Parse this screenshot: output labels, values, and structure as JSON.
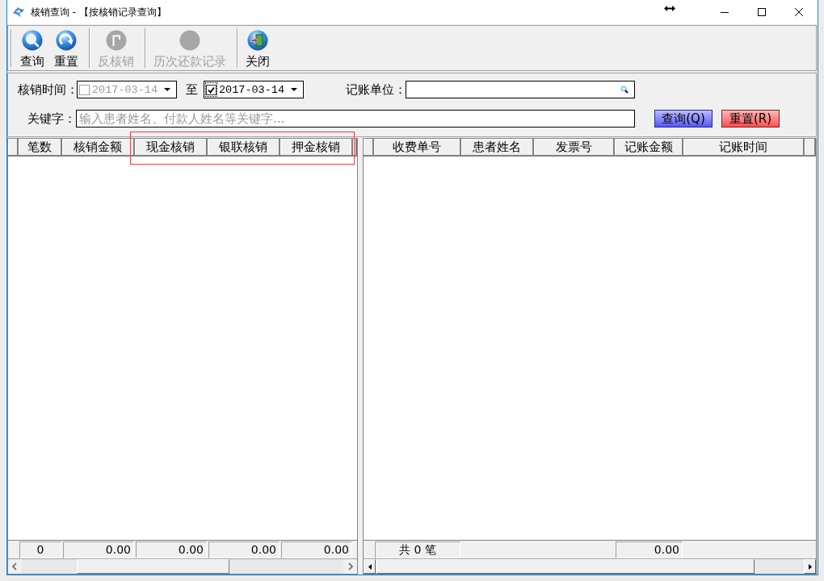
{
  "window": {
    "title": "核销查询 - 【按核销记录查询】"
  },
  "toolbar": {
    "groups": [
      {
        "buttons": [
          {
            "label": "查询",
            "kind": "search",
            "disabled": false
          },
          {
            "label": "重置",
            "kind": "refresh",
            "disabled": false
          }
        ]
      },
      {
        "buttons": [
          {
            "label": "反核销",
            "kind": "reverse",
            "disabled": true
          }
        ]
      },
      {
        "buttons": [
          {
            "label": "历次还款记录",
            "kind": "history",
            "disabled": true
          }
        ]
      },
      {
        "buttons": [
          {
            "label": "关闭",
            "kind": "exit",
            "disabled": false
          }
        ]
      }
    ]
  },
  "filters": {
    "date_label": "核销时间：",
    "date_from": {
      "checked": false,
      "focused": false,
      "value": "2017-03-14"
    },
    "range_separator": "至",
    "date_to": {
      "checked": true,
      "focused": true,
      "value": "2017-03-14"
    },
    "account_unit": {
      "label": "记账单位："
    },
    "keyword": {
      "label": "关键字：",
      "placeholder": "输入患者姓名、付款人姓名等关键字..."
    },
    "buttons": [
      {
        "label": "查询(Q)",
        "kind": "query"
      },
      {
        "label": "重置(R)",
        "kind": "reset"
      }
    ]
  },
  "summary_table": {
    "columns": [
      {
        "label": "笔数",
        "total": "0"
      },
      {
        "label": "核销金额",
        "total": "0.00"
      }
    ],
    "outlined_columns": [
      {
        "label": "现金核销",
        "total": "0.00"
      },
      {
        "label": "银联核销",
        "total": "0.00"
      },
      {
        "label": "押金核销",
        "total": "0.00"
      }
    ]
  },
  "detail_table": {
    "columns": [
      {
        "label": "收费单号",
        "total": "共 0 笔"
      },
      {
        "label": "患者姓名"
      },
      {
        "label": "发票号"
      },
      {
        "label": "记账金额",
        "total": "0.00"
      },
      {
        "label": "记账时间"
      }
    ]
  }
}
